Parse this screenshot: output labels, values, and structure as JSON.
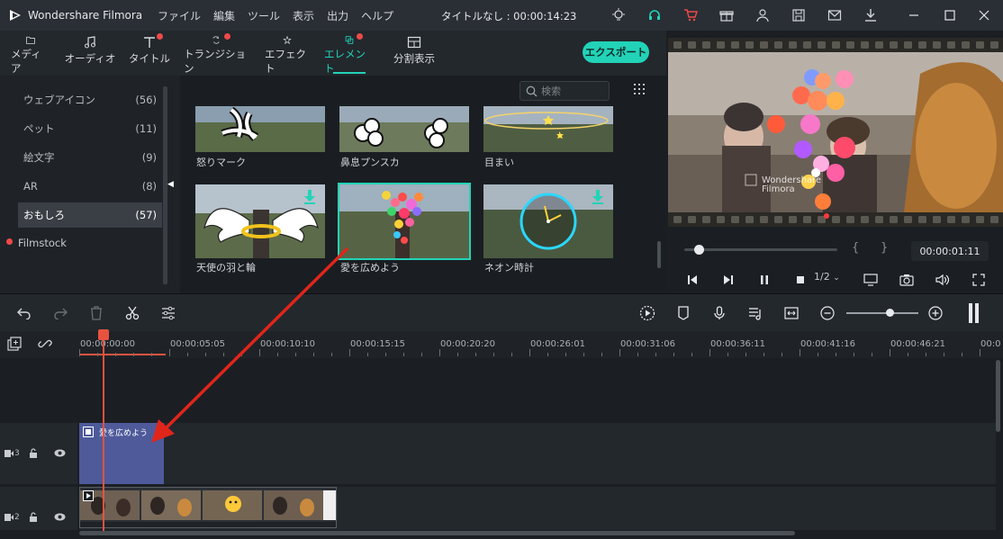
{
  "titlebar": {
    "app_name": "Wondershare Filmora",
    "menu": [
      "ファイル",
      "編集",
      "ツール",
      "表示",
      "出力",
      "ヘルプ"
    ],
    "doc_title": "タイトルなし : 00:00:14:23"
  },
  "toolbar": {
    "tabs": [
      {
        "label": "メディア",
        "icon": "folder-icon"
      },
      {
        "label": "オーディオ",
        "icon": "music-note-icon"
      },
      {
        "label": "タイトル",
        "icon": "text-icon"
      },
      {
        "label": "トランジション",
        "icon": "transition-icon"
      },
      {
        "label": "エフェクト",
        "icon": "effect-icon"
      },
      {
        "label": "エレメント",
        "icon": "element-icon"
      },
      {
        "label": "分割表示",
        "icon": "split-screen-icon"
      }
    ],
    "active_tab": "エレメント",
    "export_label": "エクスポート"
  },
  "sidebar": {
    "categories": [
      {
        "label": "ウェブアイコン",
        "count": "(56)"
      },
      {
        "label": "ペット",
        "count": "(11)"
      },
      {
        "label": "絵文字",
        "count": "(9)"
      },
      {
        "label": "AR",
        "count": "(8)"
      },
      {
        "label": "おもしろ",
        "count": "(57)"
      }
    ],
    "filmstock": "Filmstock"
  },
  "grid": {
    "search_placeholder": "検索",
    "items": [
      {
        "caption": "怒りマーク"
      },
      {
        "caption": "鼻息プンスカ"
      },
      {
        "caption": "目まい"
      },
      {
        "caption": "天使の羽と輪"
      },
      {
        "caption": "愛を広めよう"
      },
      {
        "caption": "ネオン時計"
      }
    ]
  },
  "preview": {
    "timecode": "00:00:01:11",
    "in_brace": "{",
    "out_brace": "}",
    "ratio": "1/2",
    "watermark": "Wondershare Filmora"
  },
  "timeline": {
    "ruler": [
      "00:00:00:00",
      "00:00:05:05",
      "00:00:10:10",
      "00:00:15:15",
      "00:00:20:20",
      "00:00:26:01",
      "00:00:31:06",
      "00:00:36:11",
      "00:00:41:16",
      "00:00:46:21",
      "00:0"
    ],
    "tracks": [
      {
        "number": "3"
      },
      {
        "number": "2"
      }
    ],
    "element_clip_label": "愛を広めよう"
  },
  "colors": {
    "accent": "#22d3b8",
    "notify": "#f0494a",
    "playhead": "#e8533f",
    "clip": "#4e5a9a",
    "arrow": "#e0251b"
  }
}
